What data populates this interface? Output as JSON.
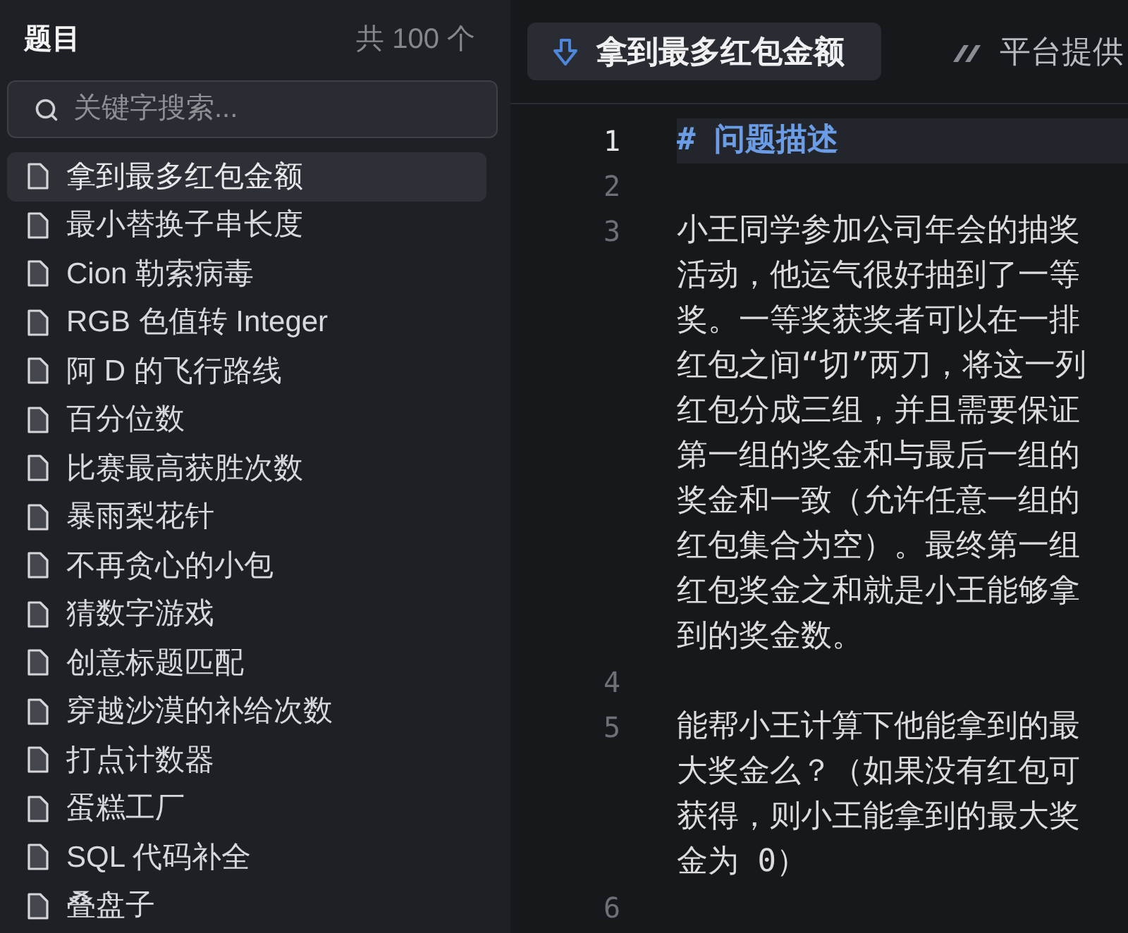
{
  "sidebar": {
    "title": "题目",
    "count": "共 100 个",
    "search": {
      "placeholder": "关键字搜索..."
    },
    "items": [
      {
        "label": "拿到最多红包金额",
        "selected": true
      },
      {
        "label": "最小替换子串长度",
        "selected": false
      },
      {
        "label": "Cion 勒索病毒",
        "selected": false
      },
      {
        "label": "RGB 色值转 Integer",
        "selected": false
      },
      {
        "label": "阿 D 的飞行路线",
        "selected": false
      },
      {
        "label": "百分位数",
        "selected": false
      },
      {
        "label": "比赛最高获胜次数",
        "selected": false
      },
      {
        "label": "暴雨梨花针",
        "selected": false
      },
      {
        "label": "不再贪心的小包",
        "selected": false
      },
      {
        "label": "猜数字游戏",
        "selected": false
      },
      {
        "label": "创意标题匹配",
        "selected": false
      },
      {
        "label": "穿越沙漠的补给次数",
        "selected": false
      },
      {
        "label": "打点计数器",
        "selected": false
      },
      {
        "label": "蛋糕工厂",
        "selected": false
      },
      {
        "label": "SQL 代码补全",
        "selected": false
      },
      {
        "label": "叠盘子",
        "selected": false
      }
    ]
  },
  "tabs": [
    {
      "label": "拿到最多红包金额",
      "selected": true,
      "kind": "arrow"
    },
    {
      "label": "平台提供",
      "selected": false,
      "kind": "stripes"
    }
  ],
  "editor": {
    "lines": [
      {
        "number": "1",
        "kind": "heading",
        "text": "# 问题描述",
        "current": true
      },
      {
        "number": "2",
        "kind": "blank",
        "current": false
      },
      {
        "number": "3",
        "kind": "paragraph",
        "text": "小王同学参加公司年会的抽奖活动，他运气很好抽到了一等奖。一等奖获奖者可以在一排红包之间“切”两刀，将这一列红包分成三组，并且需要保证第一组的奖金和与最后一组的奖金和一致（允许任意一组的红包集合为空）。最终第一组红包奖金之和就是小王能够拿到的奖金数。",
        "current": false
      },
      {
        "number": "4",
        "kind": "blank",
        "current": false
      },
      {
        "number": "5",
        "kind": "paragraph",
        "text": "能帮小王计算下他能拿到的最大奖金么？（如果没有红包可获得，则小王能拿到的最大奖金为 0）",
        "current": false
      },
      {
        "number": "6",
        "kind": "blank",
        "current": false
      }
    ]
  }
}
